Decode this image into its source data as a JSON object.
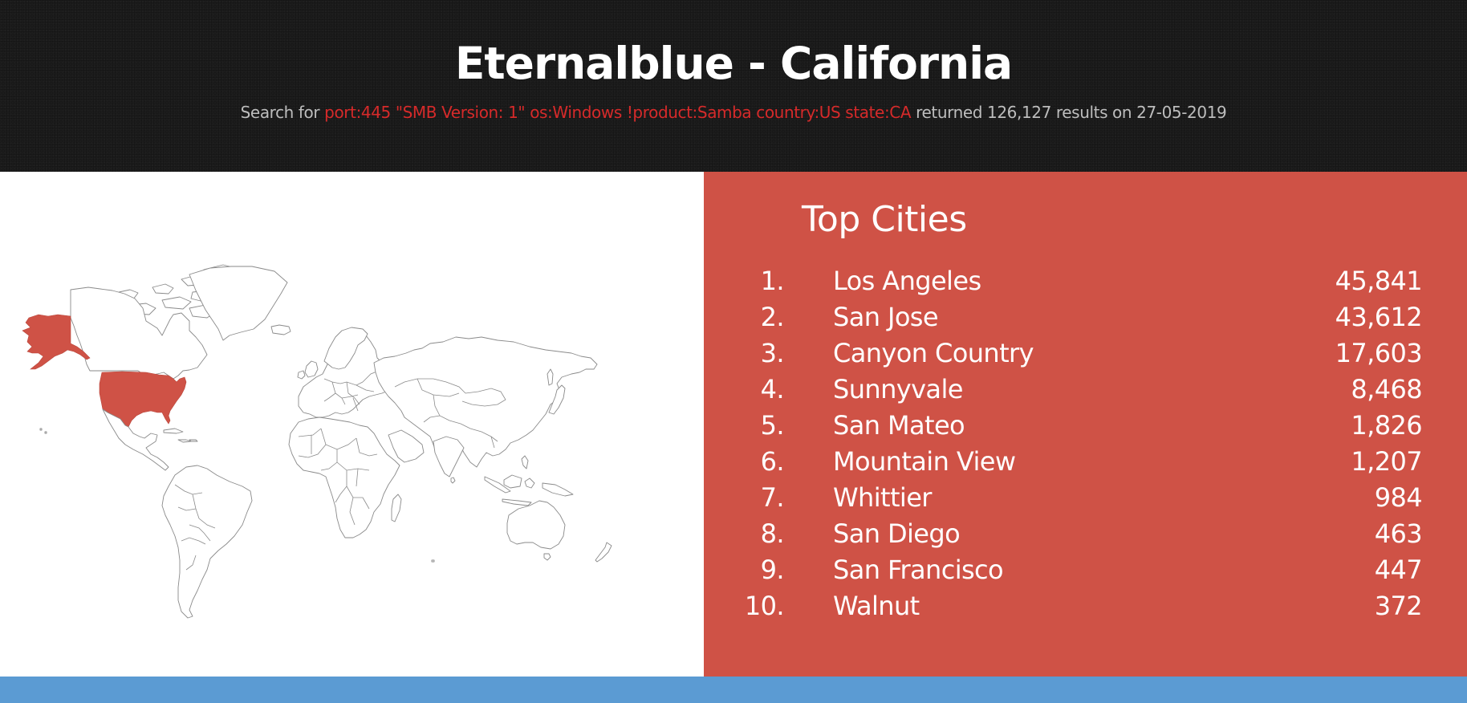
{
  "header": {
    "title": "Eternalblue - California",
    "subtitle_prefix": "Search for",
    "query": "port:445 \"SMB Version: 1\" os:Windows !product:Samba country:US state:CA",
    "subtitle_suffix": "returned 126,127 results on 27-05-2019"
  },
  "map": {
    "highlighted_country": "United States",
    "highlight_color": "#cf5246",
    "outline_color": "#8a8a8a"
  },
  "top_cities": {
    "title": "Top Cities",
    "items": [
      {
        "rank": "1.",
        "city": "Los Angeles",
        "count": "45,841"
      },
      {
        "rank": "2.",
        "city": "San Jose",
        "count": "43,612"
      },
      {
        "rank": "3.",
        "city": "Canyon Country",
        "count": "17,603"
      },
      {
        "rank": "4.",
        "city": "Sunnyvale",
        "count": "8,468"
      },
      {
        "rank": "5.",
        "city": "San Mateo",
        "count": "1,826"
      },
      {
        "rank": "6.",
        "city": "Mountain View",
        "count": "1,207"
      },
      {
        "rank": "7.",
        "city": "Whittier",
        "count": "984"
      },
      {
        "rank": "8.",
        "city": "San Diego",
        "count": "463"
      },
      {
        "rank": "9.",
        "city": "San Francisco",
        "count": "447"
      },
      {
        "rank": "10.",
        "city": "Walnut",
        "count": "372"
      }
    ]
  },
  "colors": {
    "header_bg": "#1c1c1c",
    "query_text": "#d62a2a",
    "panel_red": "#cf5246",
    "footer_blue": "#5b9bd3"
  }
}
